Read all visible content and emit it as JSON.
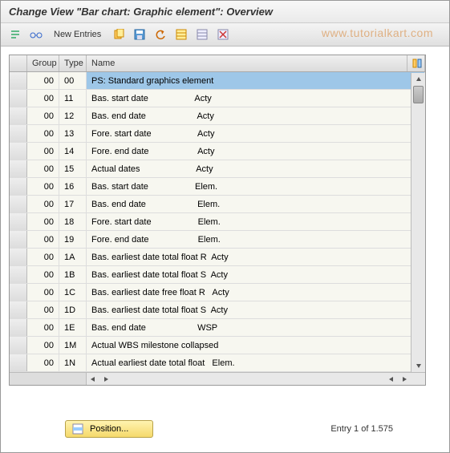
{
  "header": {
    "title": "Change View \"Bar chart:  Graphic element\": Overview"
  },
  "toolbar": {
    "new_entries_label": "New Entries",
    "watermark": "www.tutorialkart.com"
  },
  "table": {
    "headers": {
      "group": "Group",
      "type": "Type",
      "name": "Name"
    },
    "rows": [
      {
        "group": "00",
        "type": "00",
        "name": "PS: Standard graphics element",
        "selected": true
      },
      {
        "group": "00",
        "type": "11",
        "name": "Bas. start date                   Acty"
      },
      {
        "group": "00",
        "type": "12",
        "name": "Bas. end date                     Acty"
      },
      {
        "group": "00",
        "type": "13",
        "name": "Fore. start date                   Acty"
      },
      {
        "group": "00",
        "type": "14",
        "name": "Fore. end date                    Acty"
      },
      {
        "group": "00",
        "type": "15",
        "name": "Actual dates                       Acty"
      },
      {
        "group": "00",
        "type": "16",
        "name": "Bas. start date                   Elem."
      },
      {
        "group": "00",
        "type": "17",
        "name": "Bas. end date                     Elem."
      },
      {
        "group": "00",
        "type": "18",
        "name": "Fore. start date                   Elem."
      },
      {
        "group": "00",
        "type": "19",
        "name": "Fore. end date                    Elem."
      },
      {
        "group": "00",
        "type": "1A",
        "name": "Bas. earliest date total float R  Acty"
      },
      {
        "group": "00",
        "type": "1B",
        "name": "Bas. earliest date total float S  Acty"
      },
      {
        "group": "00",
        "type": "1C",
        "name": "Bas. earliest date free float R   Acty"
      },
      {
        "group": "00",
        "type": "1D",
        "name": "Bas. earliest date total float S  Acty"
      },
      {
        "group": "00",
        "type": "1E",
        "name": "Bas. end date                     WSP"
      },
      {
        "group": "00",
        "type": "1M",
        "name": "Actual WBS milestone collapsed"
      },
      {
        "group": "00",
        "type": "1N",
        "name": "Actual earliest date total float   Elem."
      }
    ]
  },
  "footer": {
    "position_label": "Position...",
    "entry_text": "Entry 1 of 1.575"
  }
}
